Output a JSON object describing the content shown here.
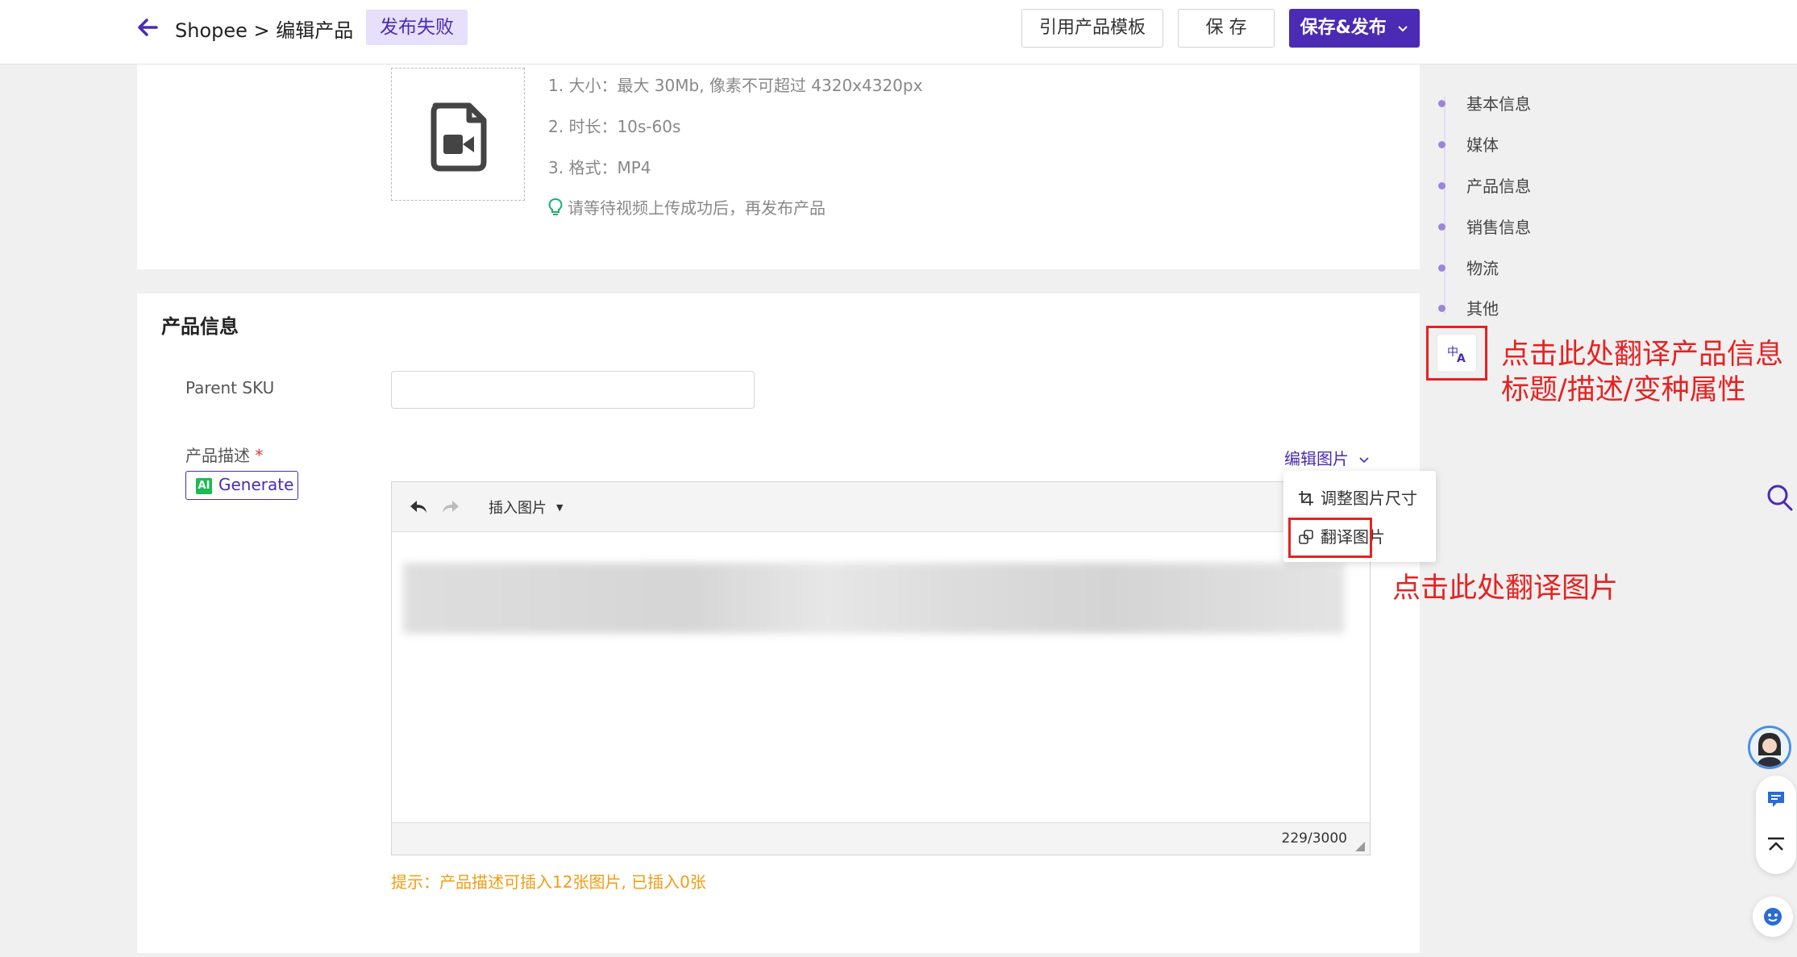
{
  "header": {
    "breadcrumb": "Shopee > 编辑产品",
    "status_badge": "发布失败",
    "btn_template": "引用产品模板",
    "btn_save": "保 存",
    "btn_publish": "保存&发布"
  },
  "media": {
    "requirements": [
      "1. 大小：最大 30Mb, 像素不可超过 4320x4320px",
      "2. 时长：10s-60s",
      "3. 格式：MP4"
    ],
    "tip": "请等待视频上传成功后，再发布产品"
  },
  "product_info": {
    "section_title": "产品信息",
    "parent_sku_label": "Parent SKU",
    "parent_sku_value": "",
    "desc_label": "产品描述",
    "required_mark": "*",
    "ai_icon": "AI",
    "ai_button": "Generate",
    "edit_image_link": "编辑图片",
    "editor": {
      "insert_image": "插入图片",
      "counter": "229/3000"
    },
    "warning": "提示：产品描述可插入12张图片, 已插入0张"
  },
  "edit_image_menu": {
    "resize": "调整图片尺寸",
    "translate": "翻译图片"
  },
  "side_nav": {
    "items": [
      "基本信息",
      "媒体",
      "产品信息",
      "销售信息",
      "物流",
      "其他"
    ]
  },
  "annotations": {
    "translate_info_line1": "点击此处翻译产品信息",
    "translate_info_line2": "标题/描述/变种属性",
    "translate_image": "点击此处翻译图片"
  },
  "colors": {
    "brand": "#4b2bb3",
    "annotation": "#e52222",
    "warning": "#f39c12"
  }
}
